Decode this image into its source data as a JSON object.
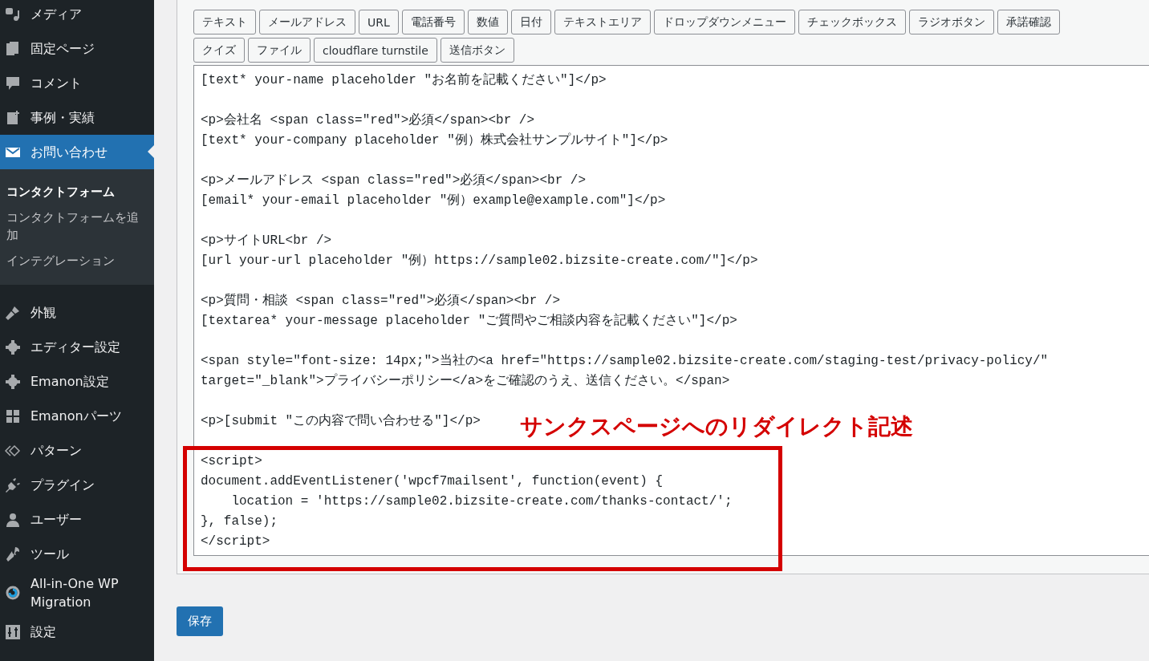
{
  "sidebar": {
    "items": [
      {
        "label": "メディア",
        "selected": false
      },
      {
        "label": "固定ページ",
        "selected": false
      },
      {
        "label": "コメント",
        "selected": false
      },
      {
        "label": "事例・実績",
        "selected": false
      },
      {
        "label": "お問い合わせ",
        "selected": true,
        "children": [
          {
            "label": "コンタクトフォーム",
            "selected": true
          },
          {
            "label": "コンタクトフォームを追加",
            "selected": false
          },
          {
            "label": "インテグレーション",
            "selected": false
          }
        ]
      },
      {
        "label": "外観",
        "selected": false
      },
      {
        "label": "エディター設定",
        "selected": false
      },
      {
        "label": "Emanon設定",
        "selected": false
      },
      {
        "label": "Emanonパーツ",
        "selected": false
      },
      {
        "label": "パターン",
        "selected": false
      },
      {
        "label": "プラグイン",
        "selected": false
      },
      {
        "label": "ユーザー",
        "selected": false
      },
      {
        "label": "ツール",
        "selected": false
      },
      {
        "label": "All-in-One WP Migration",
        "selected": false
      },
      {
        "label": "設定",
        "selected": false
      }
    ]
  },
  "tag_buttons": [
    [
      "テキスト",
      "メールアドレス",
      "URL",
      "電話番号",
      "数値",
      "日付",
      "テキストエリア",
      "ドロップダウンメニュー",
      "チェックボックス",
      "ラジオボタン",
      "承諾確認"
    ],
    [
      "クイズ",
      "ファイル",
      "cloudflare turnstile",
      "送信ボタン"
    ]
  ],
  "editor": {
    "blocks": [
      {
        "lines": [
          "[text* your-name placeholder \"お名前を記載ください\"]</p>"
        ]
      },
      {
        "lines": [
          "<p>会社名 <span class=\"red\">必須</span><br />",
          "[text* your-company placeholder \"例）株式会社サンプルサイト\"]</p>"
        ]
      },
      {
        "lines": [
          "<p>メールアドレス <span class=\"red\">必須</span><br />",
          "[email* your-email placeholder \"例）example@example.com\"]</p>"
        ]
      },
      {
        "lines": [
          "<p>サイトURL<br />",
          "[url your-url placeholder \"例）https://sample02.bizsite-create.com/\"]</p>"
        ]
      },
      {
        "lines": [
          "<p>質問・相談 <span class=\"red\">必須</span><br />",
          "[textarea* your-message placeholder \"ご質問やご相談内容を記載ください\"]</p>"
        ]
      },
      {
        "lines": [
          "<span style=\"font-size: 14px;\">当社の<a href=\"https://sample02.bizsite-create.com/staging-test/privacy-policy/\"",
          "target=\"_blank\">プライバシーポリシー</a>をご確認のうえ、送信ください。</span>"
        ]
      },
      {
        "lines": [
          "<p>[submit \"この内容で問い合わせる\"]</p>"
        ]
      },
      {
        "lines": [
          "<script>",
          "document.addEventListener('wpcf7mailsent', function(event) {",
          "    location = 'https://sample02.bizsite-create.com/thanks-contact/';",
          "}, false);",
          "</script>"
        ]
      }
    ]
  },
  "annotation": {
    "text": "サンクスページへのリダイレクト記述"
  },
  "save_button": "保存"
}
